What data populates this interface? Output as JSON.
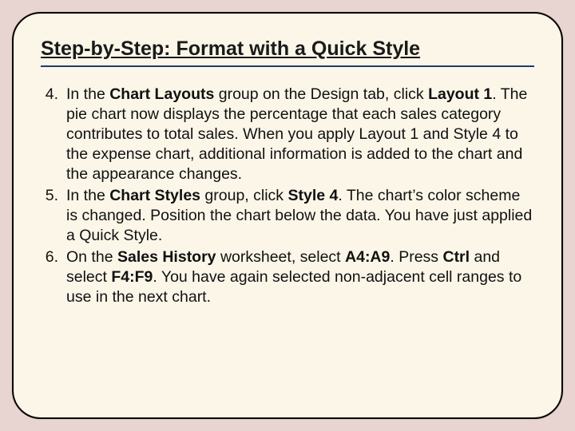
{
  "title": "Step-by-Step: Format with a Quick Style",
  "steps": [
    {
      "num": "4.",
      "runs": [
        {
          "t": "In the "
        },
        {
          "t": "Chart Layouts",
          "b": true
        },
        {
          "t": " group on the Design tab, click "
        },
        {
          "t": "Layout 1",
          "b": true
        },
        {
          "t": ". The pie chart now displays the percentage that each sales category contributes to total sales. When you apply Layout 1 and Style 4 to the expense chart, additional information is added to the chart and the appearance changes."
        }
      ]
    },
    {
      "num": "5.",
      "runs": [
        {
          "t": "In the "
        },
        {
          "t": "Chart Styles",
          "b": true
        },
        {
          "t": " group, click "
        },
        {
          "t": "Style 4",
          "b": true
        },
        {
          "t": ". The chart’s color scheme is changed. Position the chart below the data. You have just applied a Quick Style."
        }
      ]
    },
    {
      "num": "6.",
      "runs": [
        {
          "t": "On the "
        },
        {
          "t": "Sales History",
          "b": true
        },
        {
          "t": " worksheet, select "
        },
        {
          "t": "A4:A9",
          "b": true
        },
        {
          "t": ". Press "
        },
        {
          "t": "Ctrl",
          "b": true
        },
        {
          "t": " and select "
        },
        {
          "t": "F4:F9",
          "b": true
        },
        {
          "t": ". You have again selected non-adjacent cell ranges to use in the next chart."
        }
      ]
    }
  ]
}
